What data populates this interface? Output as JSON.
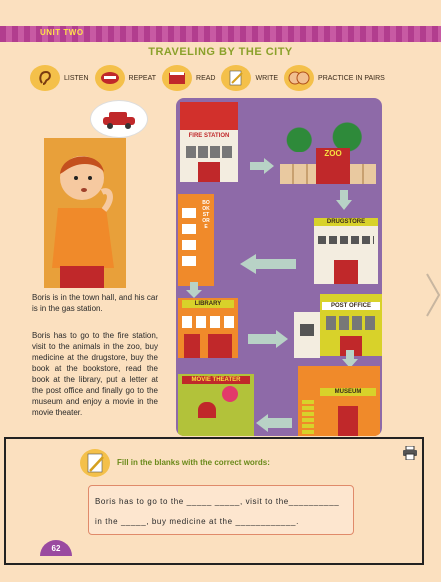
{
  "header": {
    "unit": "UNIT TWO",
    "title": "TRAVELING BY THE CITY"
  },
  "legend": [
    {
      "label": "LISTEN",
      "icon": "ear-icon"
    },
    {
      "label": "REPEAT",
      "icon": "mouth-icon"
    },
    {
      "label": "READ",
      "icon": "book-icon"
    },
    {
      "label": "WRITE",
      "icon": "pencil-paper-icon"
    },
    {
      "label": "PRACTICE IN PAIRS",
      "icon": "pair-icon"
    }
  ],
  "story": {
    "p1": "Boris is in the town hall, and his car is in the gas station.",
    "p2": "Boris has to go to the fire station, visit to the animals in the zoo, buy medicine at the drugstore, buy the book at the bookstore, read the book at the library, put a letter at the post office and finally go to the museum and enjoy a movie in the movie theater."
  },
  "map": {
    "fire_station": "FIRE STATION",
    "zoo": "ZOO",
    "bookstore": "BOOKSTORE",
    "drugstore": "DRUGSTORE",
    "library": "LIBRARY",
    "post_office": "POST OFFICE",
    "movie_theater": "MOVIE THEATER",
    "museum": "MUSEUM"
  },
  "exercise": {
    "instruction": "Fill in the blanks with the correct words:",
    "line1": "Boris has to go to the _____ _____, visit to the__________",
    "line2": "in the _____, buy medicine at the ____________."
  },
  "page_number": "62",
  "colors": {
    "accent": "#b23d8e",
    "title": "#8aa12a",
    "background": "#fbe0bf",
    "map": "#8e6aa8"
  }
}
